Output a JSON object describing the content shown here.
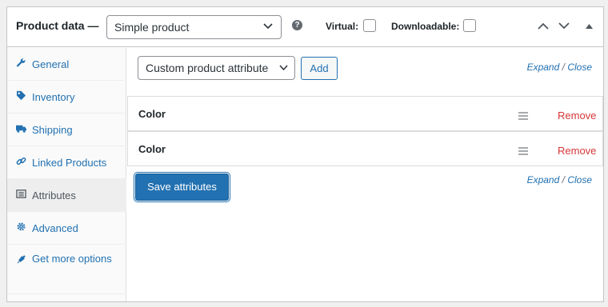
{
  "header": {
    "title": "Product data —",
    "product_type": "Simple product",
    "help_icon": "?",
    "virtual_label": "Virtual:",
    "downloadable_label": "Downloadable:"
  },
  "tabs": [
    {
      "label": "General",
      "icon": "wrench-icon"
    },
    {
      "label": "Inventory",
      "icon": "tag-icon"
    },
    {
      "label": "Shipping",
      "icon": "truck-icon"
    },
    {
      "label": "Linked Products",
      "icon": "link-icon"
    },
    {
      "label": "Attributes",
      "icon": "list-icon",
      "active": true
    },
    {
      "label": "Advanced",
      "icon": "gear-icon"
    },
    {
      "label": "Get more options",
      "icon": "plugin-icon"
    }
  ],
  "toolbar": {
    "attribute_select": "Custom product attribute",
    "add_label": "Add",
    "expand": "Expand",
    "separator": "/",
    "close": "Close"
  },
  "attributes": [
    {
      "name": "Color",
      "remove_label": "Remove"
    },
    {
      "name": "Color",
      "remove_label": "Remove"
    }
  ],
  "footer": {
    "save_label": "Save attributes",
    "expand": "Expand",
    "separator": "/",
    "close": "Close"
  },
  "colors": {
    "accent": "#2271b1",
    "danger": "#d63638",
    "border": "#c3c4c7"
  }
}
